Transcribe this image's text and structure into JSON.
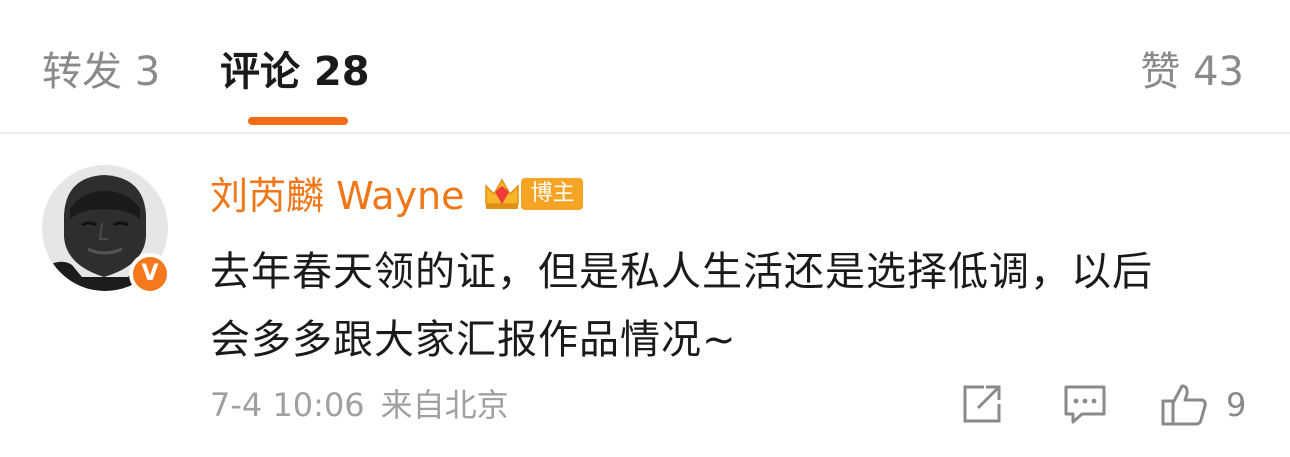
{
  "tabs": {
    "repost_label": "转发 3",
    "comments_label": "评论 28",
    "likes_label": "赞 43",
    "active": "comments"
  },
  "comment": {
    "author": "刘芮麟 Wayne",
    "badge_label": "博主",
    "verified_mark": "V",
    "text_lines": [
      "去年春天领的证，但是私人生活还是选择低调，以后",
      "会多多跟大家汇报作品情况~"
    ],
    "time": "7-4 10:06",
    "location": "来自北京",
    "like_count": "9"
  },
  "icons": {
    "share": "share-icon",
    "reply": "comment-icon",
    "like": "thumbs-up-icon",
    "crown": "crown-icon"
  },
  "colors": {
    "accent": "#f46b15",
    "author": "#f07617",
    "badge": "#f5a423",
    "muted": "#a0a0a0"
  }
}
